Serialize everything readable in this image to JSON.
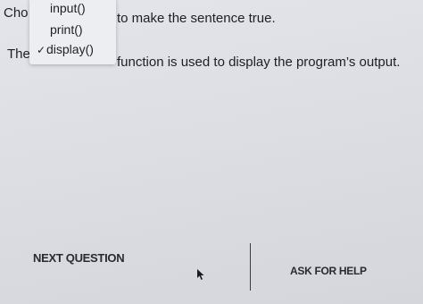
{
  "question": {
    "line1_prefix": "Cho",
    "line1_suffix": "to make the sentence true.",
    "line2_prefix": "The",
    "line2_suffix": "function is used to display the program’s output."
  },
  "dropdown": {
    "options": [
      "input()",
      "print()",
      "display()"
    ],
    "selected": "display()",
    "check_glyph": "✓"
  },
  "buttons": {
    "next": "NEXT QUESTION",
    "help": "ASK FOR HELP"
  },
  "icons": {
    "cursor": "arrow-cursor-icon"
  }
}
